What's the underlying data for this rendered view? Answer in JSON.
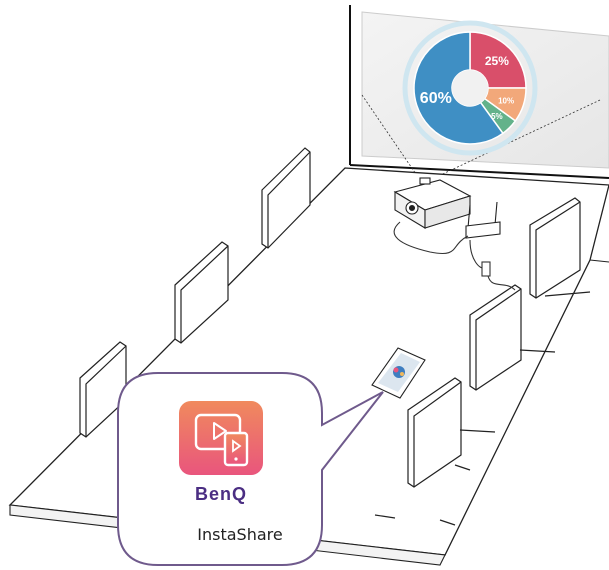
{
  "projection": {
    "chart_data": {
      "type": "pie",
      "values": [
        25,
        10,
        5,
        60
      ],
      "labels": [
        "25%",
        "10%",
        "5%",
        "60%"
      ]
    }
  },
  "app": {
    "brand": "BenQ",
    "name": "InstaShare",
    "colors": {
      "gradient_top": "#f08a5d",
      "gradient_bottom": "#e9557d",
      "brand": "#4b2e83",
      "callout_border": "#6f5a8c"
    }
  }
}
